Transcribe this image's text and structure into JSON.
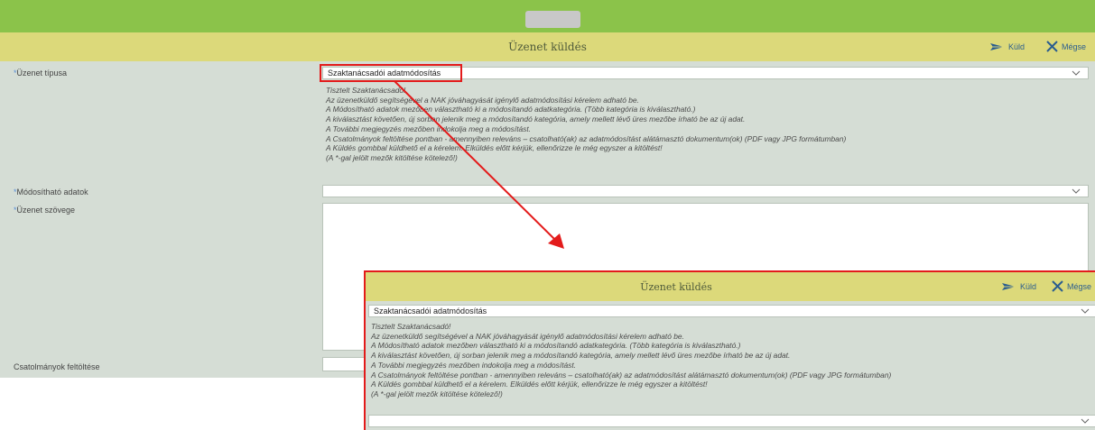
{
  "header": {
    "title": "Üzenet küldés",
    "send_label": "Küld",
    "cancel_label": "Mégse"
  },
  "form": {
    "message_type": {
      "label": "Üzenet típusa",
      "value": "Szaktanácsadói adatmódosítás"
    },
    "help_lines": [
      "Tisztelt Szaktanácsadó!",
      "Az üzenetküldő segítségével a NAK jóváhagyását igénylő adatmódosítási kérelem adható be.",
      "A Módosítható adatok mezőben választható ki a módosítandó adatkategória. (Több kategória is kiválasztható.)",
      "A kiválasztást követően, új sorban jelenik meg a módosítandó kategória, amely mellett lévő üres mezőbe írható be az új adat.",
      "A További megjegyzés mezőben indokolja meg a módosítást.",
      "A Csatolmányok feltöltése pontban - amennyiben releváns – csatolható(ak) az adatmódosítást alátámasztó dokumentum(ok) (PDF vagy JPG formátumban)",
      "A Küldés gombbal küldhető el a kérelem. Elküldés előtt kérjük, ellenőrizze le még egyszer a kitöltést!",
      "(A *-gal jelölt mezők kitöltése kötelező!)"
    ],
    "modifiable": {
      "label": "Módosítható adatok",
      "value": ""
    },
    "message_text": {
      "label": "Üzenet szövege",
      "value": ""
    },
    "attachments": {
      "label": "Csatolmányok feltöltése"
    },
    "required_mark": "*"
  },
  "colors": {
    "topbar": "#8bc34a",
    "header": "#dcd97a",
    "form_bg": "#d5ddd5",
    "link": "#2a5d8f",
    "annotation": "#e31b1b"
  },
  "icons": [
    "send-icon",
    "close-icon",
    "chevron-down-icon"
  ]
}
